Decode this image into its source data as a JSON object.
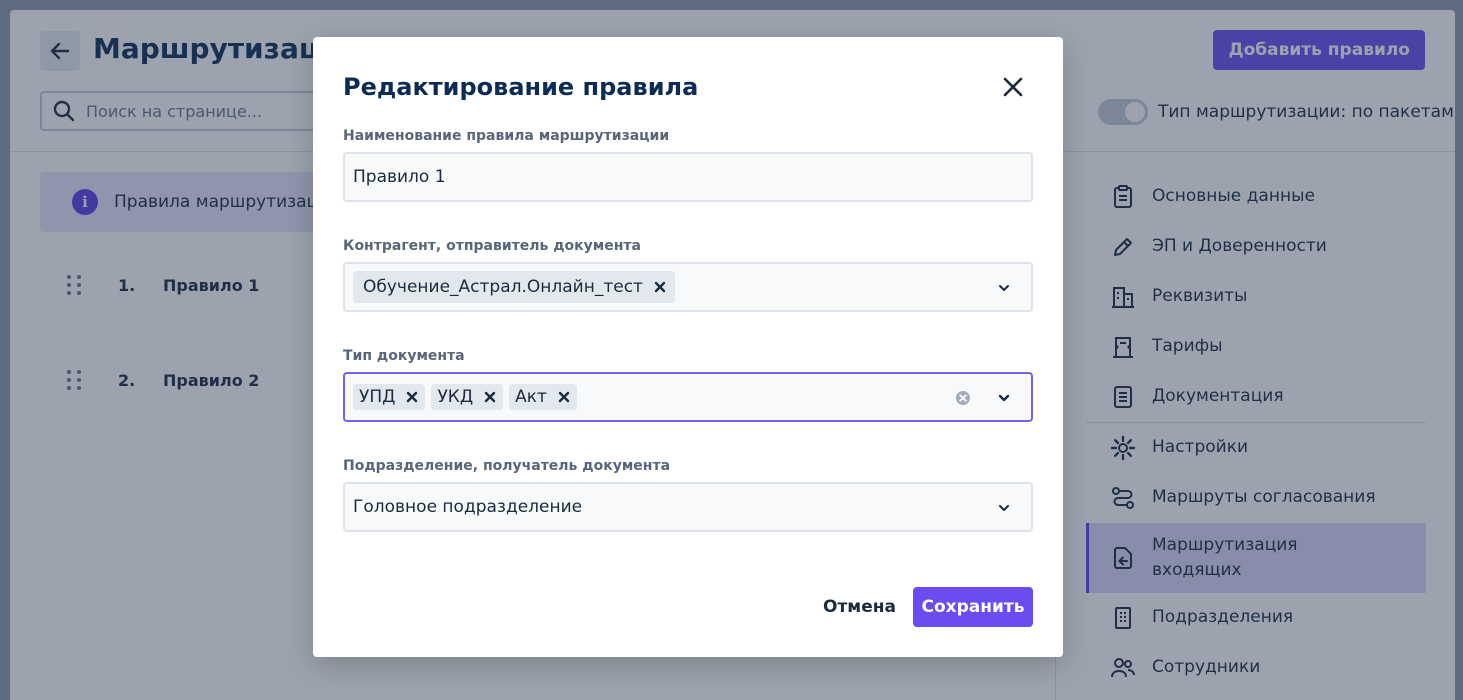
{
  "page": {
    "title": "Маршрутизаци",
    "search_placeholder": "Поиск на странице...",
    "add_rule_label": "Добавить правило",
    "routing_type_label": "Тип маршрутизации: по пакетам",
    "info_text": "Правила маршрутизаци",
    "info_icon_glyph": "i",
    "rules": [
      {
        "num": "1.",
        "name": "Правило 1"
      },
      {
        "num": "2.",
        "name": "Правило 2"
      }
    ],
    "nav": [
      {
        "label": "Основные данные",
        "icon": "clipboard-icon"
      },
      {
        "label": "ЭП и Доверенности",
        "icon": "pen-icon"
      },
      {
        "label": "Реквизиты",
        "icon": "building-icon"
      },
      {
        "label": "Тарифы",
        "icon": "tariff-icon"
      },
      {
        "label": "Документация",
        "icon": "document-icon"
      },
      {
        "label": "Настройки",
        "icon": "gear-icon"
      },
      {
        "label": "Маршруты согласования",
        "icon": "route-icon"
      },
      {
        "label": "Маршрутизация входящих",
        "icon": "incoming-routing-icon",
        "active": true
      },
      {
        "label": "Подразделения",
        "icon": "office-icon"
      },
      {
        "label": "Сотрудники",
        "icon": "users-icon"
      }
    ]
  },
  "modal": {
    "title": "Редактирование правила",
    "name_label": "Наименование правила маршрутизации",
    "name_value": "Правило 1",
    "counterparty_label": "Контрагент, отправитель документа",
    "counterparty_chips": [
      "Обучение_Астрал.Онлайн_тест"
    ],
    "doctype_label": "Тип документа",
    "doctype_chips": [
      "УПД",
      "УКД",
      "Акт"
    ],
    "division_label": "Подразделение, получатель документа",
    "division_value": "Головное подразделение",
    "cancel_label": "Отмена",
    "save_label": "Сохранить"
  },
  "colors": {
    "accent": "#6a4cf0",
    "title": "#0c2c55",
    "overlay": "rgba(40,54,78,0.46)"
  }
}
